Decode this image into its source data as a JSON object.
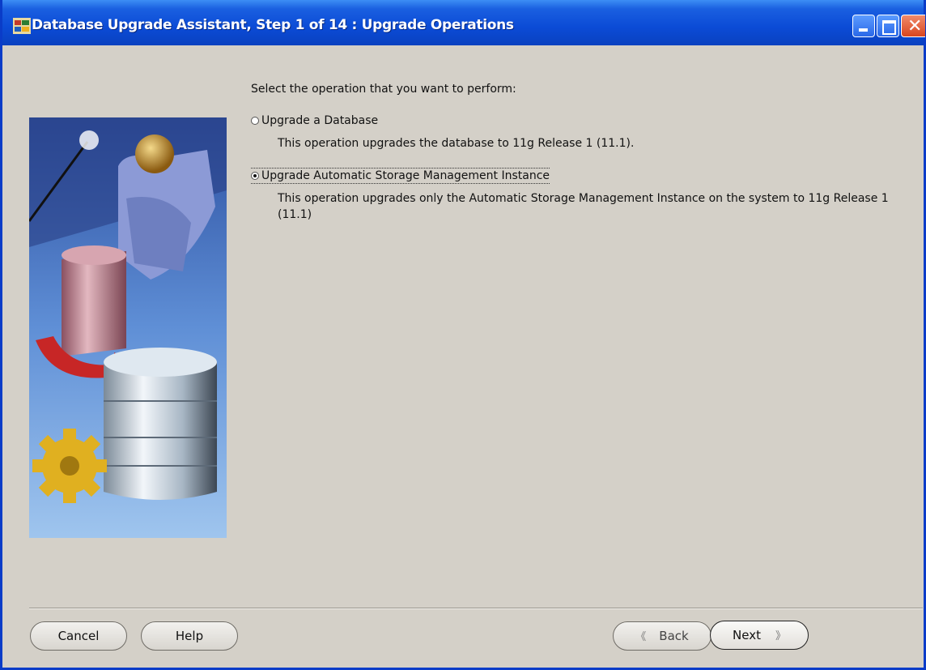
{
  "window": {
    "title": "Database Upgrade Assistant, Step 1 of 14 : Upgrade Operations",
    "icon": "oracle-app-icon"
  },
  "content": {
    "prompt": "Select the operation that you want to perform:",
    "options": [
      {
        "label": "Upgrade a Database",
        "description": "This operation upgrades the database to 11g Release 1 (11.1).",
        "selected": false
      },
      {
        "label": "Upgrade Automatic Storage Management Instance",
        "description": "This operation upgrades only the Automatic Storage Management Instance on the system to 11g Release 1 (11.1)",
        "selected": true
      }
    ]
  },
  "buttons": {
    "cancel": "Cancel",
    "help": "Help",
    "back": "Back",
    "next": "Next"
  }
}
